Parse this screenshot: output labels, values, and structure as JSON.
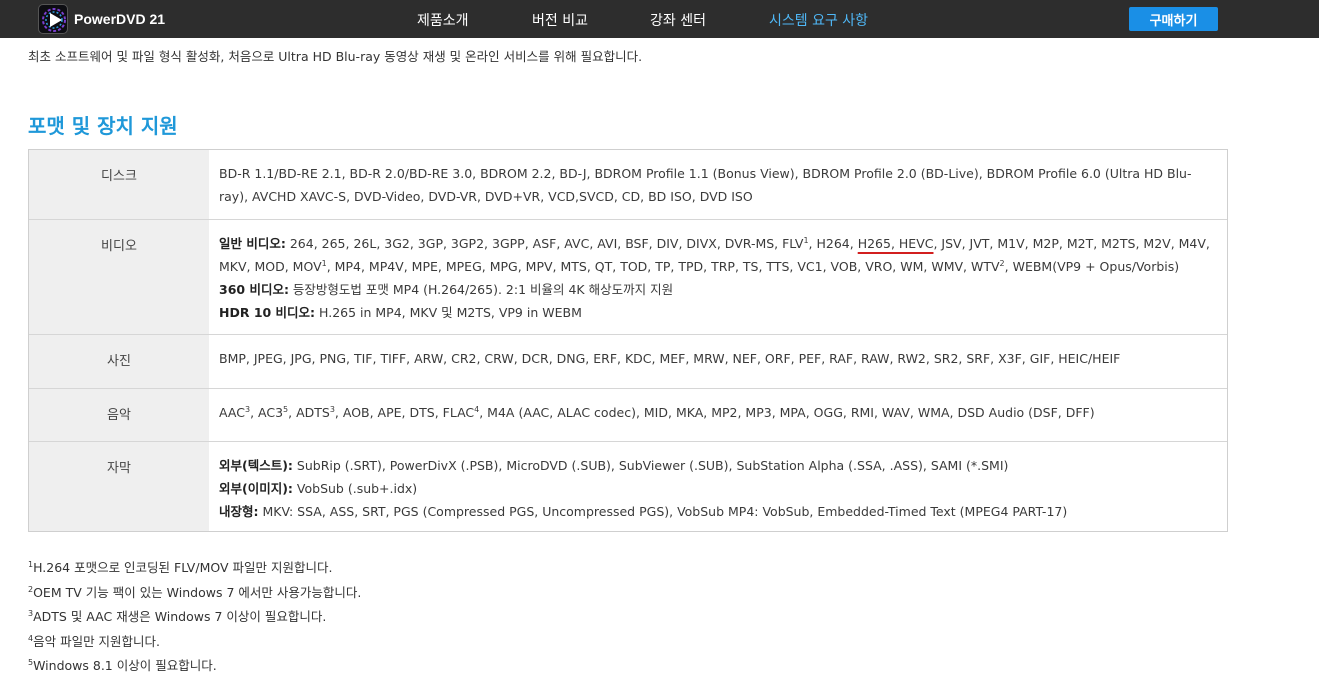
{
  "header": {
    "brand": "PowerDVD 21",
    "nav": [
      "제품소개",
      "버전 비교",
      "강좌 센터",
      "시스템 요구 사항"
    ],
    "active_index": 3,
    "buy_label": "구매하기",
    "accent_color": "#4fb8f7",
    "buy_color": "#1a8fe6"
  },
  "intro": "최초 소프트웨어 및 파일 형식 활성화, 처음으로 Ultra HD Blu-ray 동영상 재생 및 온라인 서비스를 위해 필요합니다.",
  "section_title": "포맷 및 장치 지원",
  "rows": {
    "disc": {
      "label": "디스크",
      "text": "BD-R 1.1/BD-RE 2.1, BD-R 2.0/BD-RE 3.0, BDROM 2.2, BD-J, BDROM Profile 1.1 (Bonus View), BDROM Profile 2.0 (BD-Live), BDROM Profile 6.0 (Ultra HD Blu-ray), AVCHD XAVC-S, DVD-Video, DVD-VR, DVD+VR, VCD,SVCD, CD, BD ISO, DVD ISO"
    },
    "video": {
      "label": "비디오",
      "general_label": "일반 비디오:",
      "general_p1": " 264, 265, 26L, 3G2, 3GP, 3GP2, 3GPP, ASF, AVC, AVI, BSF, DIV, DIVX, DVR-MS, FLV",
      "sup1": "1",
      "general_p2": ", H264, ",
      "highlight": "H265, HEVC",
      "general_p3": ", JSV, JVT, M1V, M2P, M2T, M2TS, M2V, M4V, MKV, MOD, MOV",
      "general_p4": ", MP4, MP4V, MPE, MPEG, MPG, MPV, MTS, QT, TOD, TP, TPD, TRP, TS, TTS, VC1, VOB, VRO, WM, WMV, WTV",
      "sup2": "2",
      "general_p5": ", WEBM(VP9 + Opus/Vorbis)",
      "v360_label": "360 비디오:",
      "v360_text": " 등장방형도법 포맷 MP4 (H.264/265). 2:1 비율의 4K 해상도까지 지원",
      "hdr_label": "HDR 10 비디오:",
      "hdr_text": " H.265 in MP4, MKV 및 M2TS, VP9 in WEBM"
    },
    "photo": {
      "label": "사진",
      "text": "BMP, JPEG, JPG, PNG, TIF, TIFF, ARW, CR2, CRW, DCR, DNG, ERF, KDC, MEF, MRW, NEF, ORF, PEF, RAF, RAW, RW2, SR2, SRF, X3F, GIF, HEIC/HEIF"
    },
    "music": {
      "label": "음악",
      "p1": "AAC",
      "sup3": "3",
      "p2": ", AC3",
      "sup5": "5",
      "p3": ", ADTS",
      "p4": ", AOB, APE, DTS, FLAC",
      "sup4": "4",
      "p5": ", M4A (AAC, ALAC codec), MID, MKA, MP2, MP3, MPA, OGG, RMI, WAV, WMA, DSD Audio (DSF, DFF)"
    },
    "subtitle": {
      "label": "자막",
      "ext_text_label": "외부(텍스트):",
      "ext_text": " SubRip (.SRT), PowerDivX (.PSB), MicroDVD (.SUB), SubViewer (.SUB), SubStation Alpha (.SSA, .ASS), SAMI (*.SMI)",
      "ext_image_label": "외부(이미지):",
      "ext_image": " VobSub (.sub+.idx)",
      "embedded_label": "내장형:",
      "embedded": " MKV: SSA, ASS, SRT, PGS (Compressed PGS, Uncompressed PGS), VobSub MP4: VobSub, Embedded-Timed Text (MPEG4 PART-17)"
    }
  },
  "footnotes": [
    {
      "num": "1",
      "text": "H.264 포맷으로 인코딩된 FLV/MOV 파일만 지원합니다."
    },
    {
      "num": "2",
      "text": "OEM TV 기능 팩이 있는 Windows 7 에서만 사용가능합니다."
    },
    {
      "num": "3",
      "text": "ADTS 및 AAC 재생은 Windows 7 이상이 필요합니다."
    },
    {
      "num": "4",
      "text": "음악 파일만 지원합니다."
    },
    {
      "num": "5",
      "text": "Windows 8.1 이상이 필요합니다."
    }
  ]
}
